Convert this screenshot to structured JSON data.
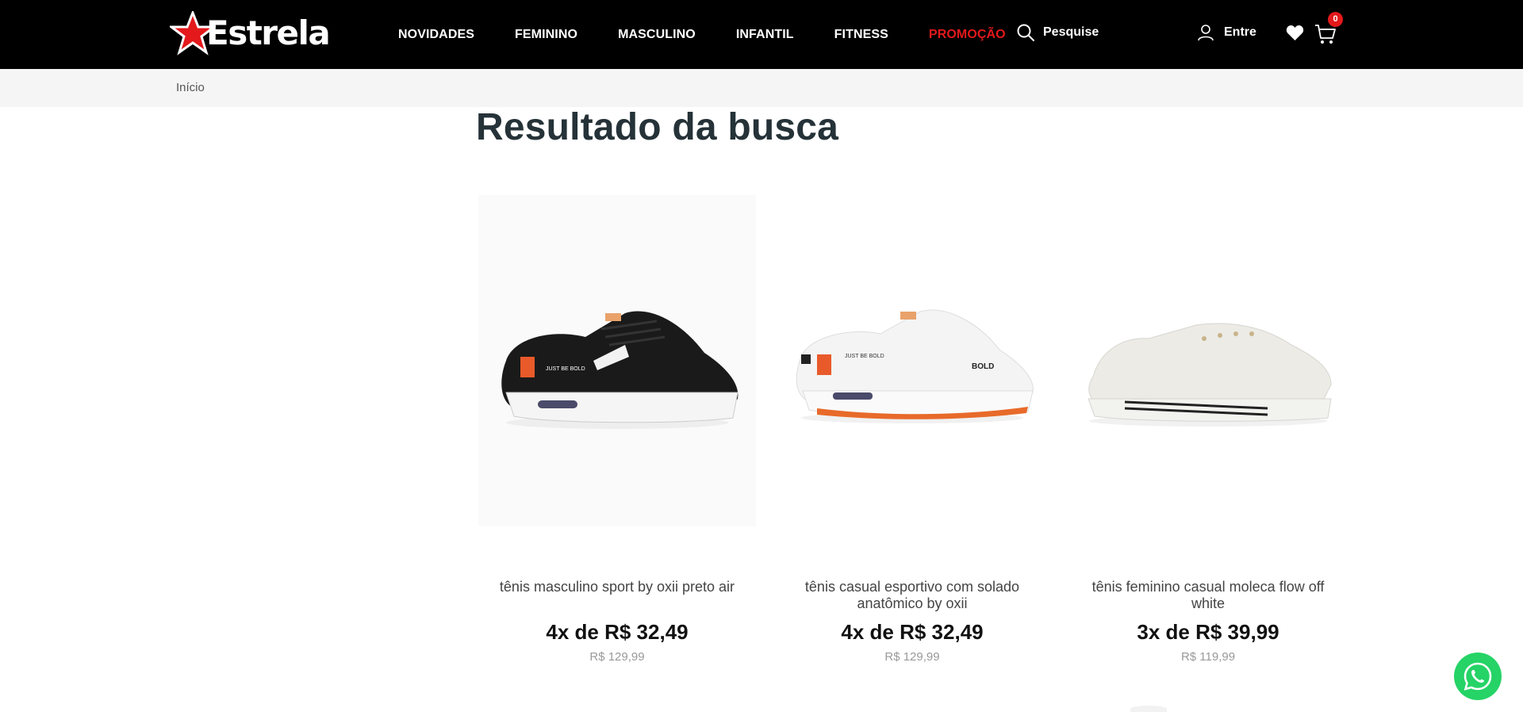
{
  "header": {
    "logo_text": "Estrela",
    "nav": [
      "NOVIDADES",
      "FEMININO",
      "MASCULINO",
      "INFANTIL",
      "FITNESS",
      "PROMOÇÃO"
    ],
    "search_label": "Pesquise",
    "login_label": "Entre",
    "cart_count": "0"
  },
  "breadcrumb": {
    "home": "Início"
  },
  "page": {
    "title": "Resultado da busca"
  },
  "products": [
    {
      "name": "tênis masculino sport by oxii preto air",
      "installment": "4x de R$ 32,49",
      "old_price": "R$ 129,99"
    },
    {
      "name": "tênis casual esportivo com solado anatômico by oxii",
      "installment": "4x de R$ 32,49",
      "old_price": "R$ 129,99"
    },
    {
      "name": "tênis feminino casual moleca flow off white",
      "installment": "3x de R$ 39,99",
      "old_price": "R$ 119,99"
    }
  ],
  "colors": {
    "brand_red": "#e3191b",
    "header_bg": "#000000",
    "whatsapp": "#25d366"
  }
}
